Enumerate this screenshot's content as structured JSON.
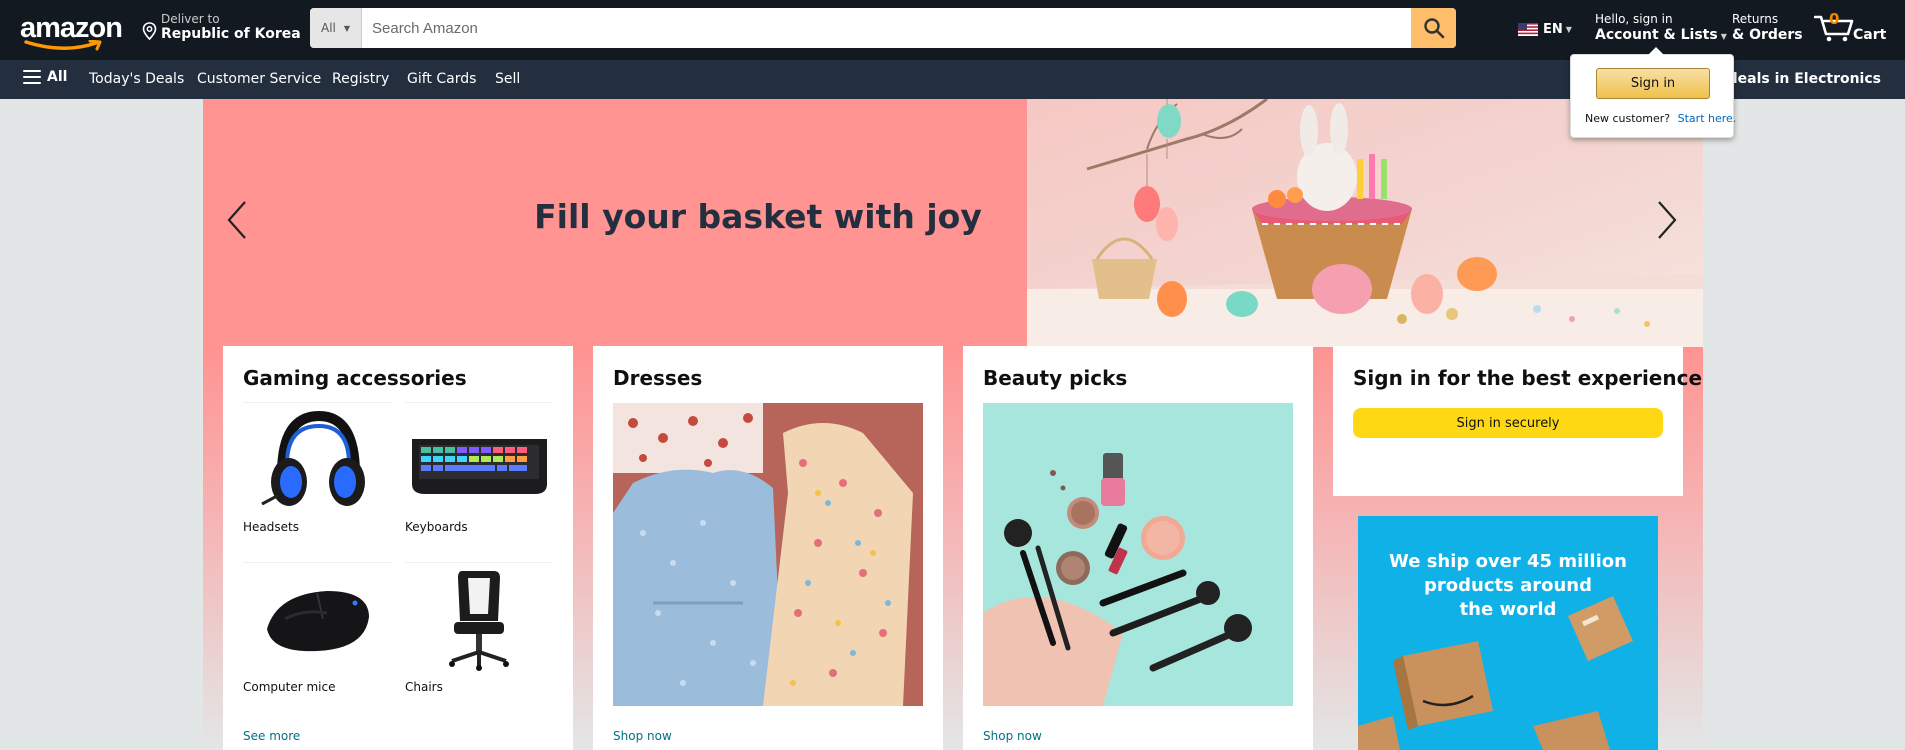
{
  "nav": {
    "logo_text": "amazon",
    "deliver_line1": "Deliver to",
    "deliver_line2": "Republic of Korea",
    "search_category": "All",
    "search_placeholder": "Search Amazon",
    "language": "EN",
    "account_line1": "Hello, sign in",
    "account_line2": "Account & Lists",
    "orders_line1": "Returns",
    "orders_line2": "& Orders",
    "cart_count": "0",
    "cart_label": "Cart"
  },
  "subnav": {
    "all_label": "All",
    "items": [
      "Today's Deals",
      "Customer Service",
      "Registry",
      "Gift Cards",
      "Sell"
    ],
    "promo": "Shop deals in Electronics"
  },
  "flyout": {
    "sign_in": "Sign in",
    "new_customer": "New customer?",
    "start_here": "Start here."
  },
  "hero": {
    "headline": "Fill your basket with joy"
  },
  "cards": {
    "gaming": {
      "title": "Gaming accessories",
      "items": [
        "Headsets",
        "Keyboards",
        "Computer mice",
        "Chairs"
      ],
      "link": "See more"
    },
    "dresses": {
      "title": "Dresses",
      "link": "Shop now"
    },
    "beauty": {
      "title": "Beauty picks",
      "link": "Shop now"
    },
    "signin": {
      "title": "Sign in for the best experience",
      "button": "Sign in securely"
    },
    "ship": {
      "line1": "We ship over 45 million",
      "line2": "products around",
      "line3": "the world"
    }
  },
  "colors": {
    "nav_bg": "#131921",
    "subnav_bg": "#232f3e",
    "search_button": "#febd69",
    "hero_pink": "#ff9492",
    "signin_button": "#ffd814",
    "link": "#007185",
    "ship_blue": "#0fb1e6"
  }
}
